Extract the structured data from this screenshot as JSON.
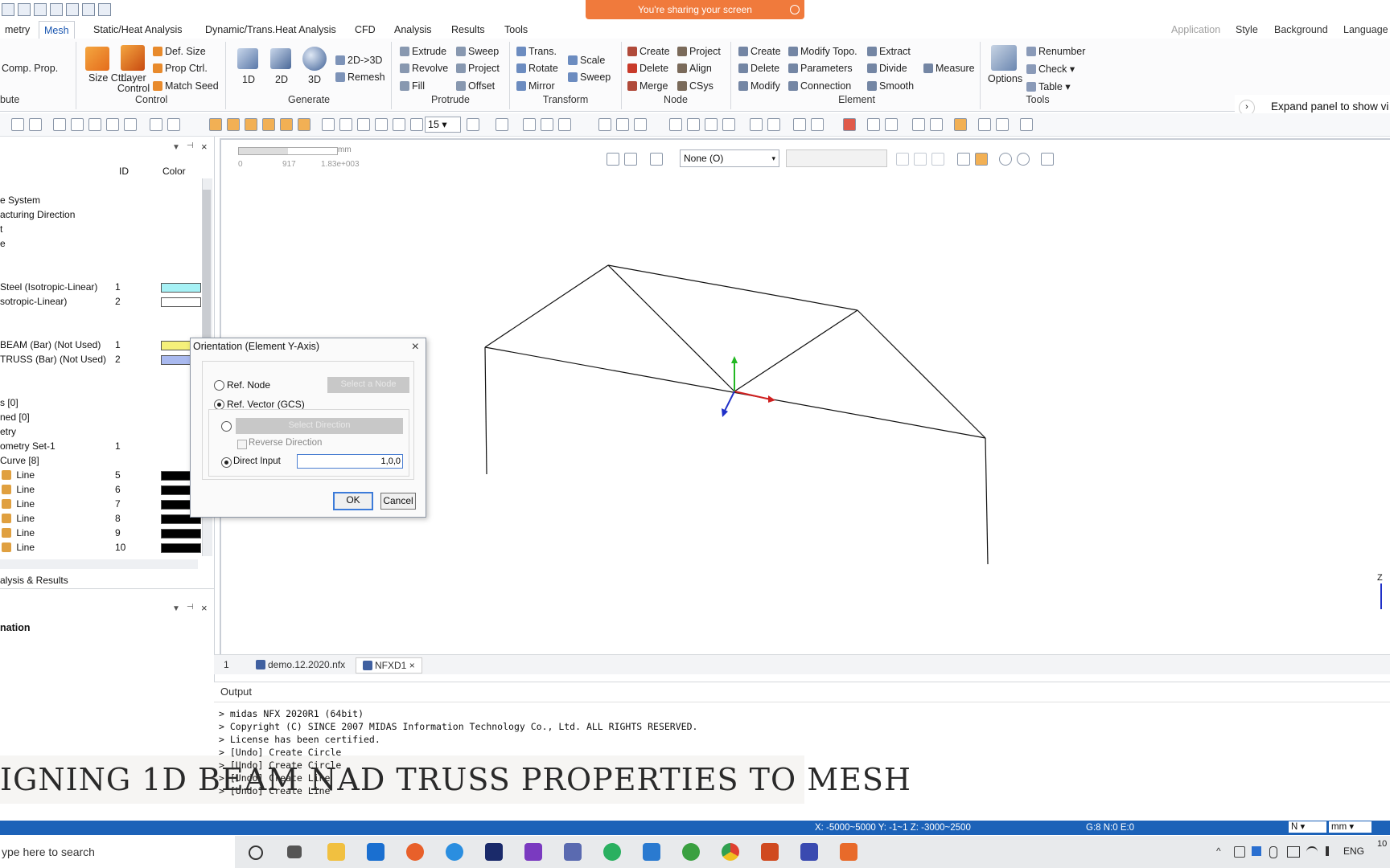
{
  "sharing": {
    "text": "You're sharing your screen"
  },
  "tabs": [
    {
      "label": "metry"
    },
    {
      "label": "Mesh"
    },
    {
      "label": "Static/Heat Analysis"
    },
    {
      "label": "Dynamic/Trans.Heat Analysis"
    },
    {
      "label": "CFD"
    },
    {
      "label": "Analysis"
    },
    {
      "label": "Results"
    },
    {
      "label": "Tools"
    }
  ],
  "right_tabs": [
    {
      "label": "Application"
    },
    {
      "label": "Style"
    },
    {
      "label": "Background"
    },
    {
      "label": "Language"
    }
  ],
  "ribbon": {
    "comp_prop": "Comp. Prop.",
    "attribute_group": "bute",
    "control": {
      "size_ctrl": "Size Ctrl.",
      "layer_control": "Layer Control",
      "def_size": "Def. Size",
      "prop_ctrl": "Prop Ctrl.",
      "match_seed": "Match Seed",
      "group": "Control"
    },
    "generate": {
      "d1": "1D",
      "d2": "2D",
      "d3": "3D",
      "to3d": "2D->3D",
      "remesh": "Remesh",
      "group": "Generate"
    },
    "protrude": {
      "extrude": "Extrude",
      "revolve": "Revolve",
      "fill": "Fill",
      "sweep": "Sweep",
      "project": "Project",
      "offset": "Offset",
      "group": "Protrude"
    },
    "transform": {
      "trans": "Trans.",
      "rotate": "Rotate",
      "mirror": "Mirror",
      "scale": "Scale",
      "sweep": "Sweep",
      "group": "Transform"
    },
    "node": {
      "create": "Create",
      "delete": "Delete",
      "merge": "Merge",
      "project": "Project",
      "align": "Align",
      "csys": "CSys",
      "group": "Node"
    },
    "element": {
      "create": "Create",
      "delete": "Delete",
      "modify": "Modify",
      "modify_topo": "Modify Topo.",
      "parameters": "Parameters",
      "connection": "Connection",
      "extract": "Extract",
      "divide": "Divide",
      "smooth": "Smooth",
      "measure": "Measure",
      "group": "Element"
    },
    "tools": {
      "options": "Options",
      "renumber": "Renumber",
      "check": "Check",
      "table": "Table",
      "group": "Tools"
    }
  },
  "expand_panel": "Expand panel to show vi",
  "toolbar": {
    "zoom_value": "15"
  },
  "tree": {
    "col_id": "ID",
    "col_color": "Color",
    "rows": [
      {
        "label": "e System",
        "id": "",
        "color": ""
      },
      {
        "label": "acturing Direction",
        "id": "",
        "color": ""
      },
      {
        "label": "t",
        "id": "",
        "color": ""
      },
      {
        "label": "e",
        "id": "",
        "color": ""
      },
      {
        "label": "Steel (Isotropic-Linear)",
        "id": "1",
        "color": "#a6f1f5"
      },
      {
        "label": "sotropic-Linear)",
        "id": "2",
        "color": "#ffffff"
      },
      {
        "label": "BEAM (Bar) (Not Used)",
        "id": "1",
        "color": "#f5f07a"
      },
      {
        "label": "TRUSS (Bar) (Not Used)",
        "id": "2",
        "color": "#a9b9ef"
      },
      {
        "label": "s [0]",
        "id": "",
        "color": ""
      },
      {
        "label": "ned [0]",
        "id": "",
        "color": ""
      },
      {
        "label": "etry",
        "id": "",
        "color": ""
      },
      {
        "label": "ometry Set-1",
        "id": "1",
        "color": ""
      },
      {
        "label": "Curve [8]",
        "id": "",
        "color": ""
      },
      {
        "label": "Line",
        "id": "5",
        "color": "#000000"
      },
      {
        "label": "Line",
        "id": "6",
        "color": "#000000"
      },
      {
        "label": "Line",
        "id": "7",
        "color": "#000000"
      },
      {
        "label": "Line",
        "id": "8",
        "color": "#000000"
      },
      {
        "label": "Line",
        "id": "9",
        "color": "#000000"
      },
      {
        "label": "Line",
        "id": "10",
        "color": "#000000"
      }
    ],
    "analysis_results": "alysis & Results",
    "nation": "nation"
  },
  "viewport": {
    "scale_unit": "mm",
    "scale_ticks": [
      "0",
      "917",
      "1.83e+003"
    ],
    "select_value": "None (O)",
    "axis_label": "Z"
  },
  "dialog": {
    "title": "Orientation (Element Y-Axis)",
    "ref_node": "Ref. Node",
    "select_node": "Select a Node",
    "ref_vector": "Ref. Vector (GCS)",
    "select_direction": "Select Direction",
    "reverse_direction": "Reverse Direction",
    "direct_input": "Direct Input",
    "direct_value": "1,0,0",
    "ok": "OK",
    "cancel": "Cancel"
  },
  "doc_tabs": [
    {
      "label": "1"
    },
    {
      "label": "demo.12.2020.nfx"
    },
    {
      "label": "NFXD1"
    }
  ],
  "output": {
    "header": "Output",
    "lines": [
      "> midas NFX 2020R1 (64bit)",
      "> Copyright (C) SINCE 2007 MIDAS Information Technology Co., Ltd. ALL RIGHTS RESERVED.",
      "> License has been certified.",
      "> [Undo] Create Circle",
      "> [Undo] Create Circle",
      "> [Undo] Create Line",
      "> [Undo] Create Line"
    ]
  },
  "banner": "IGNING 1D BEAM NAD TRUSS PROPERTIES TO MESH",
  "status": {
    "coords": "X: -5000~5000 Y: -1~1 Z: -3000~2500",
    "counts": "G:8 N:0 E:0",
    "n_select": "N",
    "unit_select": "mm"
  },
  "taskbar": {
    "search": "ype here to search",
    "lang": "ENG",
    "time": "10"
  }
}
